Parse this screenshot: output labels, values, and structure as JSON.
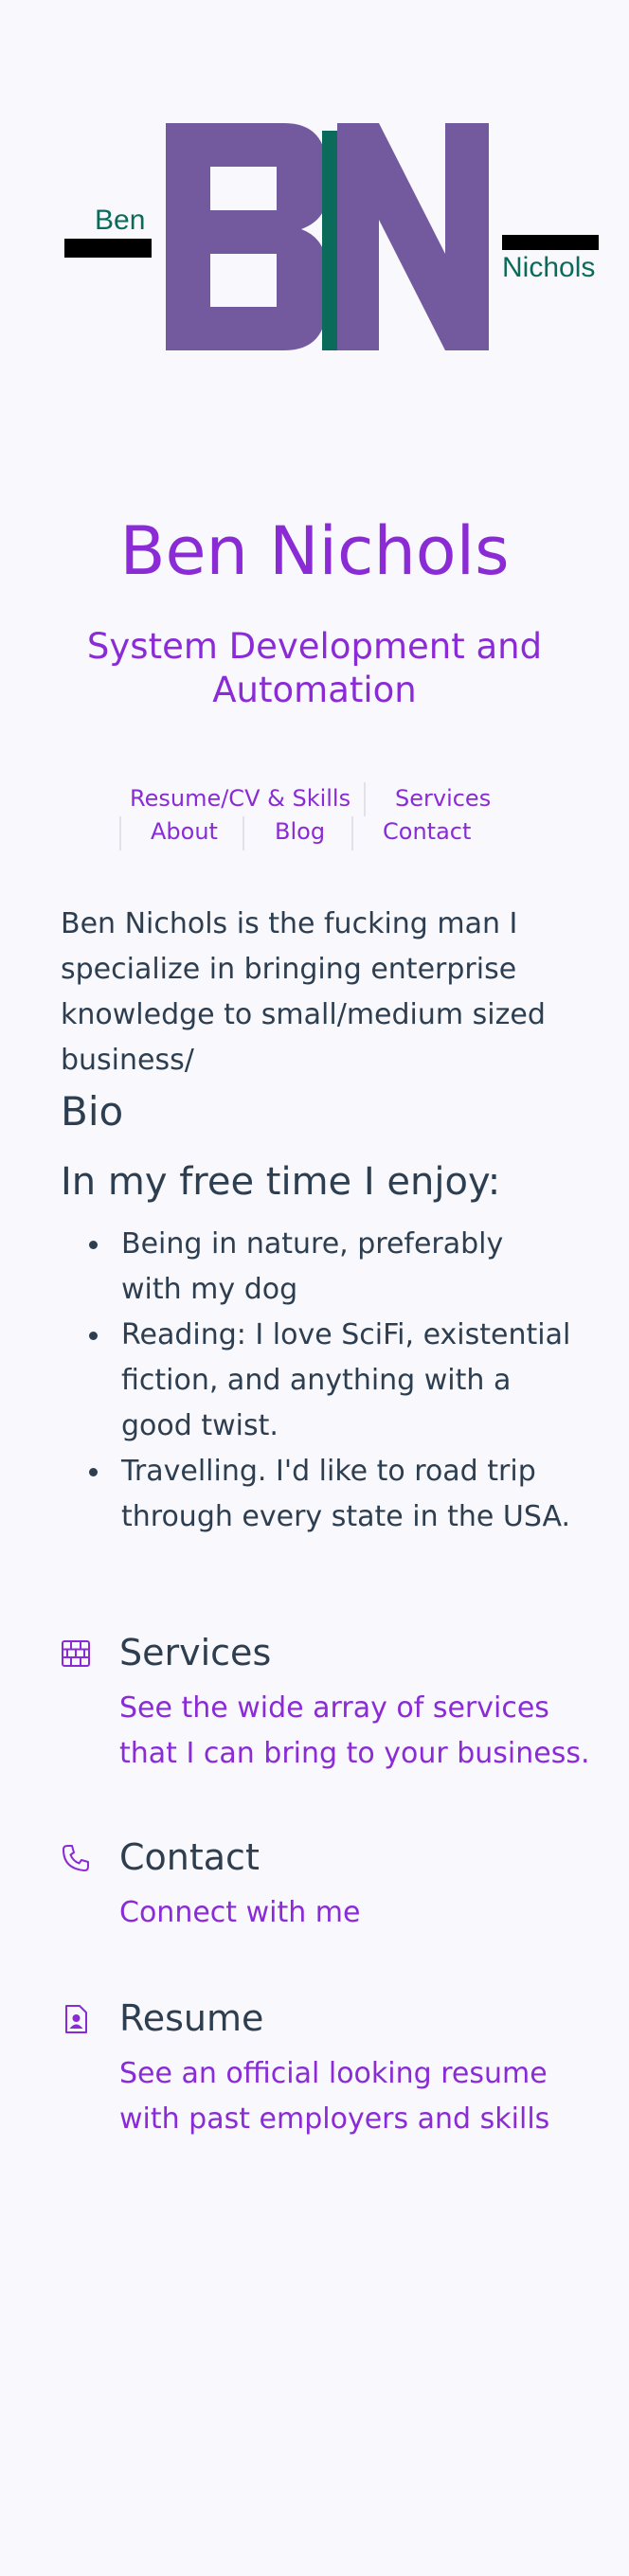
{
  "logo": {
    "first_name": "Ben",
    "last_name": "Nichols",
    "colors": {
      "purple": "#735a9e",
      "green": "#0b6b5a",
      "black": "#000000"
    }
  },
  "site": {
    "title": "Ben Nichols",
    "subtitle": "System Development and Automation"
  },
  "nav": {
    "items": [
      {
        "label": "Resume/CV & Skills"
      },
      {
        "label": "Services"
      },
      {
        "label": "About"
      },
      {
        "label": "Blog"
      },
      {
        "label": "Contact"
      }
    ]
  },
  "intro": "Ben Nichols is the fucking man I specialize in bringing enterprise knowledge to small/medium sized business/",
  "bio": {
    "heading": "Bio",
    "free_time_heading": "In my free time I enjoy:",
    "hobbies": [
      "Being in nature, preferably with my dog",
      "Reading: I love SciFi, existential fiction, and anything with a good twist.",
      "Travelling. I'd like to road trip through every state in the USA."
    ]
  },
  "features": [
    {
      "icon": "brick-wall-icon",
      "title": "Services",
      "description": "See the wide array of services that I can bring to your business."
    },
    {
      "icon": "phone-icon",
      "title": "Contact",
      "description": "Connect with me"
    },
    {
      "icon": "resume-file-icon",
      "title": "Resume",
      "description": "See an official looking resume with past employers and skills"
    }
  ],
  "colors": {
    "accent": "#8a2bd6",
    "text": "#2c3e50",
    "background": "#f9f8fd"
  }
}
